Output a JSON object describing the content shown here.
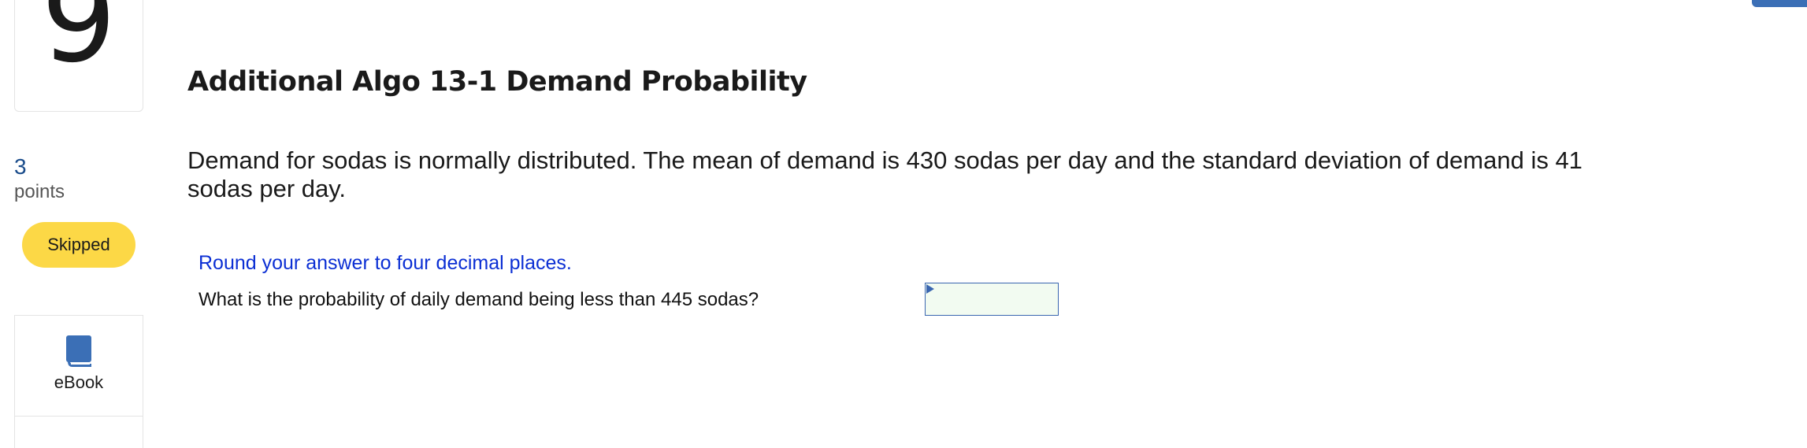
{
  "question": {
    "number": "9",
    "title": "Additional Algo 13-1 Demand Probability",
    "points_value": "3",
    "points_label": "points",
    "status": "Skipped",
    "problem_text": "Demand for sodas is normally distributed. The mean of demand is 430 sodas per day and the standard deviation of demand is 41 sodas per day.",
    "instruction": "Round your answer to four decimal places.",
    "prompt": "What is the probability of daily demand being less than 445 sodas?",
    "answer_value": ""
  },
  "resources": {
    "ebook_label": "eBook",
    "ebook_icon": "book-icon"
  },
  "colors": {
    "accent_blue": "#3b6fb6",
    "skipped_badge": "#fcd846",
    "instruction_text": "#0b2fd4",
    "input_bg": "#f2fbf1"
  }
}
